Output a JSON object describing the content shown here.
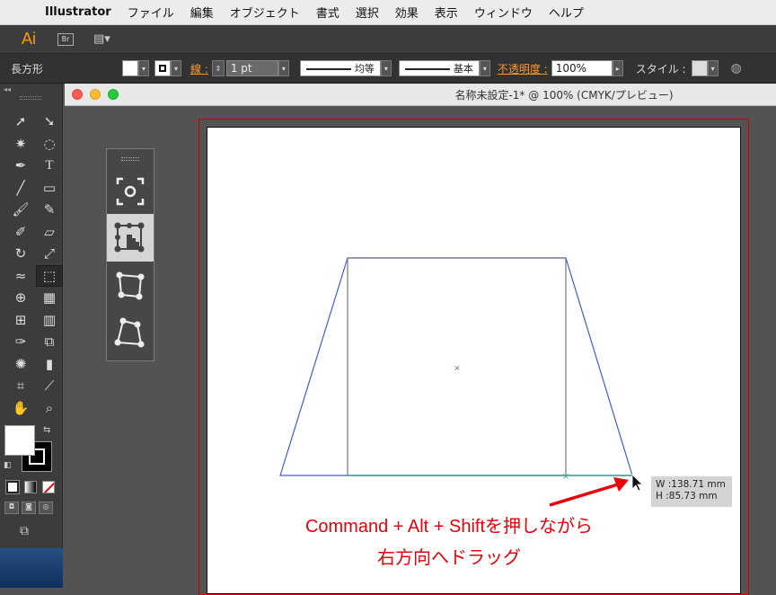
{
  "menubar": {
    "app_name": "Illustrator",
    "items": [
      "ファイル",
      "編集",
      "オブジェクト",
      "書式",
      "選択",
      "効果",
      "表示",
      "ウィンドウ",
      "ヘルプ"
    ]
  },
  "appbar": {
    "logo": "Ai",
    "bridge": "Br"
  },
  "control_bar": {
    "object_type": "長方形",
    "stroke_label": "線 :",
    "stroke_weight": "1 pt",
    "stroke_profile": "均等",
    "brush": "基本",
    "opacity_label": "不透明度 :",
    "opacity_value": "100%",
    "style_label": "スタイル :"
  },
  "document": {
    "title": "名称未設定-1* @ 100% (CMYK/プレビュー)"
  },
  "tooltip": {
    "width": "W :138.71 mm",
    "height": "H :85.73 mm"
  },
  "annotation": {
    "line1": "Command + Alt + Shiftを押しながら",
    "line2": "右方向へドラッグ"
  },
  "colors": {
    "accent_orange": "#ff9a2a",
    "annotation_red": "#e8000b",
    "path_blue": "#3d5fd1",
    "artboard_border": "#cc0000"
  }
}
